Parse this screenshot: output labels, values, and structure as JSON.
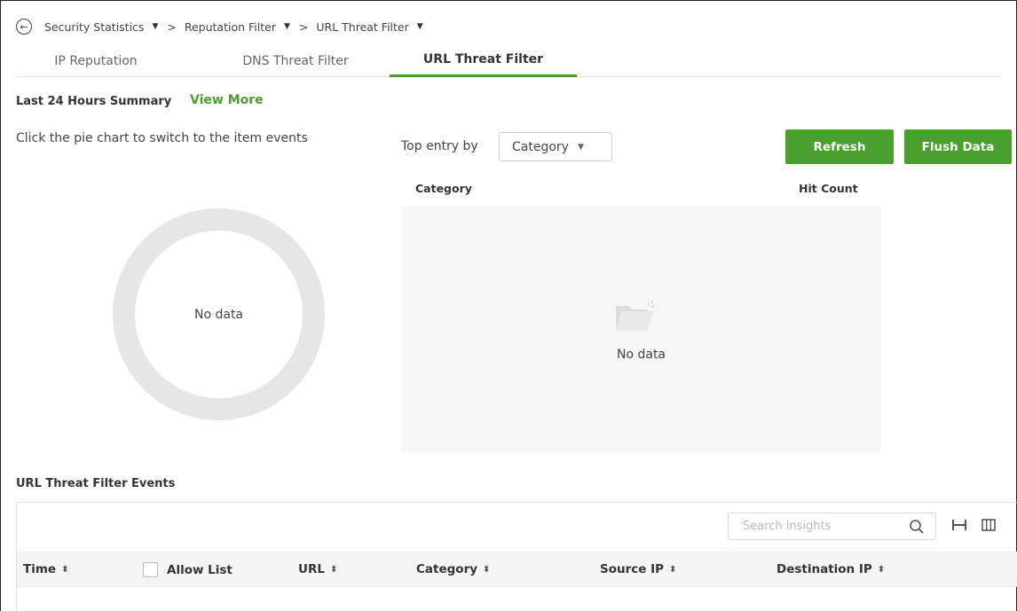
{
  "breadcrumb": {
    "items": [
      "Security Statistics",
      "Reputation Filter",
      "URL Threat Filter"
    ],
    "separator": ">"
  },
  "tabs": [
    {
      "label": "IP Reputation",
      "active": false
    },
    {
      "label": "DNS Threat Filter",
      "active": false
    },
    {
      "label": "URL Threat Filter",
      "active": true
    }
  ],
  "summary": {
    "title": "Last 24 Hours Summary",
    "view_more": "View More",
    "hint": "Click the pie chart to switch to the item events",
    "pie_no_data": "No data"
  },
  "top_entry": {
    "label": "Top entry by",
    "selected": "Category"
  },
  "buttons": {
    "refresh": "Refresh",
    "flush": "Flush Data"
  },
  "top_table": {
    "columns": [
      "Category",
      "Hit Count"
    ],
    "empty_text": "No data"
  },
  "events": {
    "title": "URL Threat Filter Events",
    "search_placeholder": "Search insights",
    "columns": [
      "Time",
      "Allow List",
      "URL",
      "Category",
      "Source IP",
      "Destination IP"
    ]
  },
  "colors": {
    "accent": "#4aa02c",
    "empty_fill": "#e6e6e6"
  },
  "icons": [
    "back-arrow-icon",
    "caret-down-icon",
    "folder-icon",
    "search-icon",
    "column-width-icon",
    "columns-icon",
    "sort-icon"
  ]
}
